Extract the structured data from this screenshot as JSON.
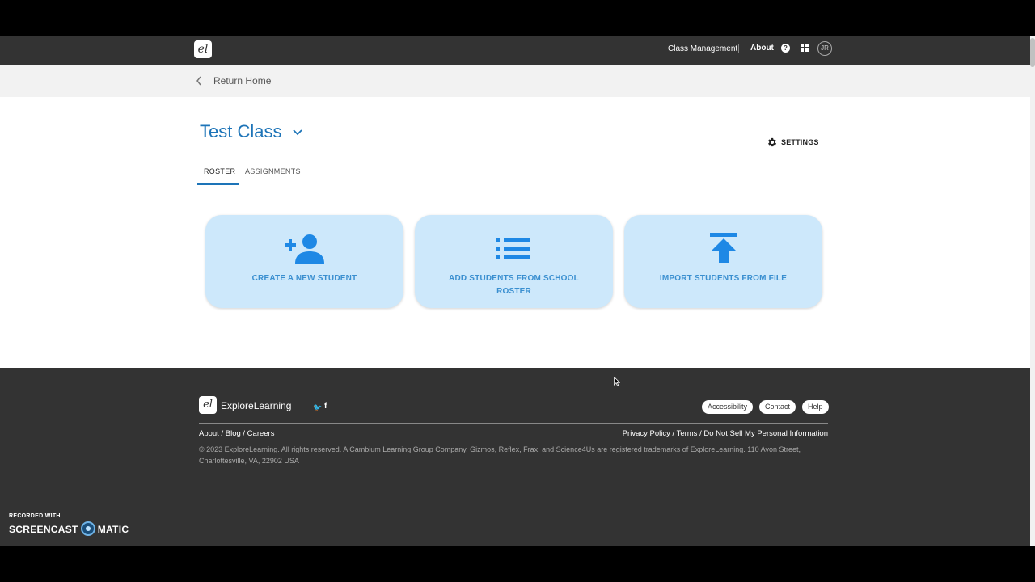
{
  "topnav": {
    "logo_text": "el",
    "class_management": "Class Management",
    "about": "About",
    "help_glyph": "?",
    "avatar_initials": "JR"
  },
  "returnbar": {
    "label": "Return Home"
  },
  "main": {
    "class_title": "Test Class",
    "settings_label": "SETTINGS",
    "tabs": [
      {
        "label": "ROSTER",
        "active": true
      },
      {
        "label": "ASSIGNMENTS",
        "active": false
      }
    ],
    "cards": [
      {
        "label": "CREATE A NEW STUDENT",
        "icon": "add-person-icon"
      },
      {
        "label": "ADD STUDENTS FROM SCHOOL ROSTER",
        "icon": "list-icon"
      },
      {
        "label": "IMPORT STUDENTS FROM FILE",
        "icon": "upload-icon"
      }
    ],
    "accent_color": "#1d74b8",
    "card_color": "#cde8fb"
  },
  "footer": {
    "logo_text": "el",
    "brand": "ExploreLearning",
    "twitter_glyph": "🐦",
    "facebook_glyph": "f",
    "buttons": [
      "Accessibility",
      "Contact",
      "Help"
    ],
    "links_left": "About / Blog / Careers",
    "links_right": "Privacy Policy / Terms / Do Not Sell My Personal Information",
    "copyright": "© 2023 ExploreLearning. All rights reserved. A Cambium Learning Group Company. Gizmos, Reflex, Frax, and Science4Us are registered trademarks of ExploreLearning. 110 Avon Street, Charlottesville, VA, 22902 USA"
  },
  "watermark": {
    "line1": "RECORDED WITH",
    "brand_a": "SCREENCAST",
    "brand_b": "MATIC"
  }
}
